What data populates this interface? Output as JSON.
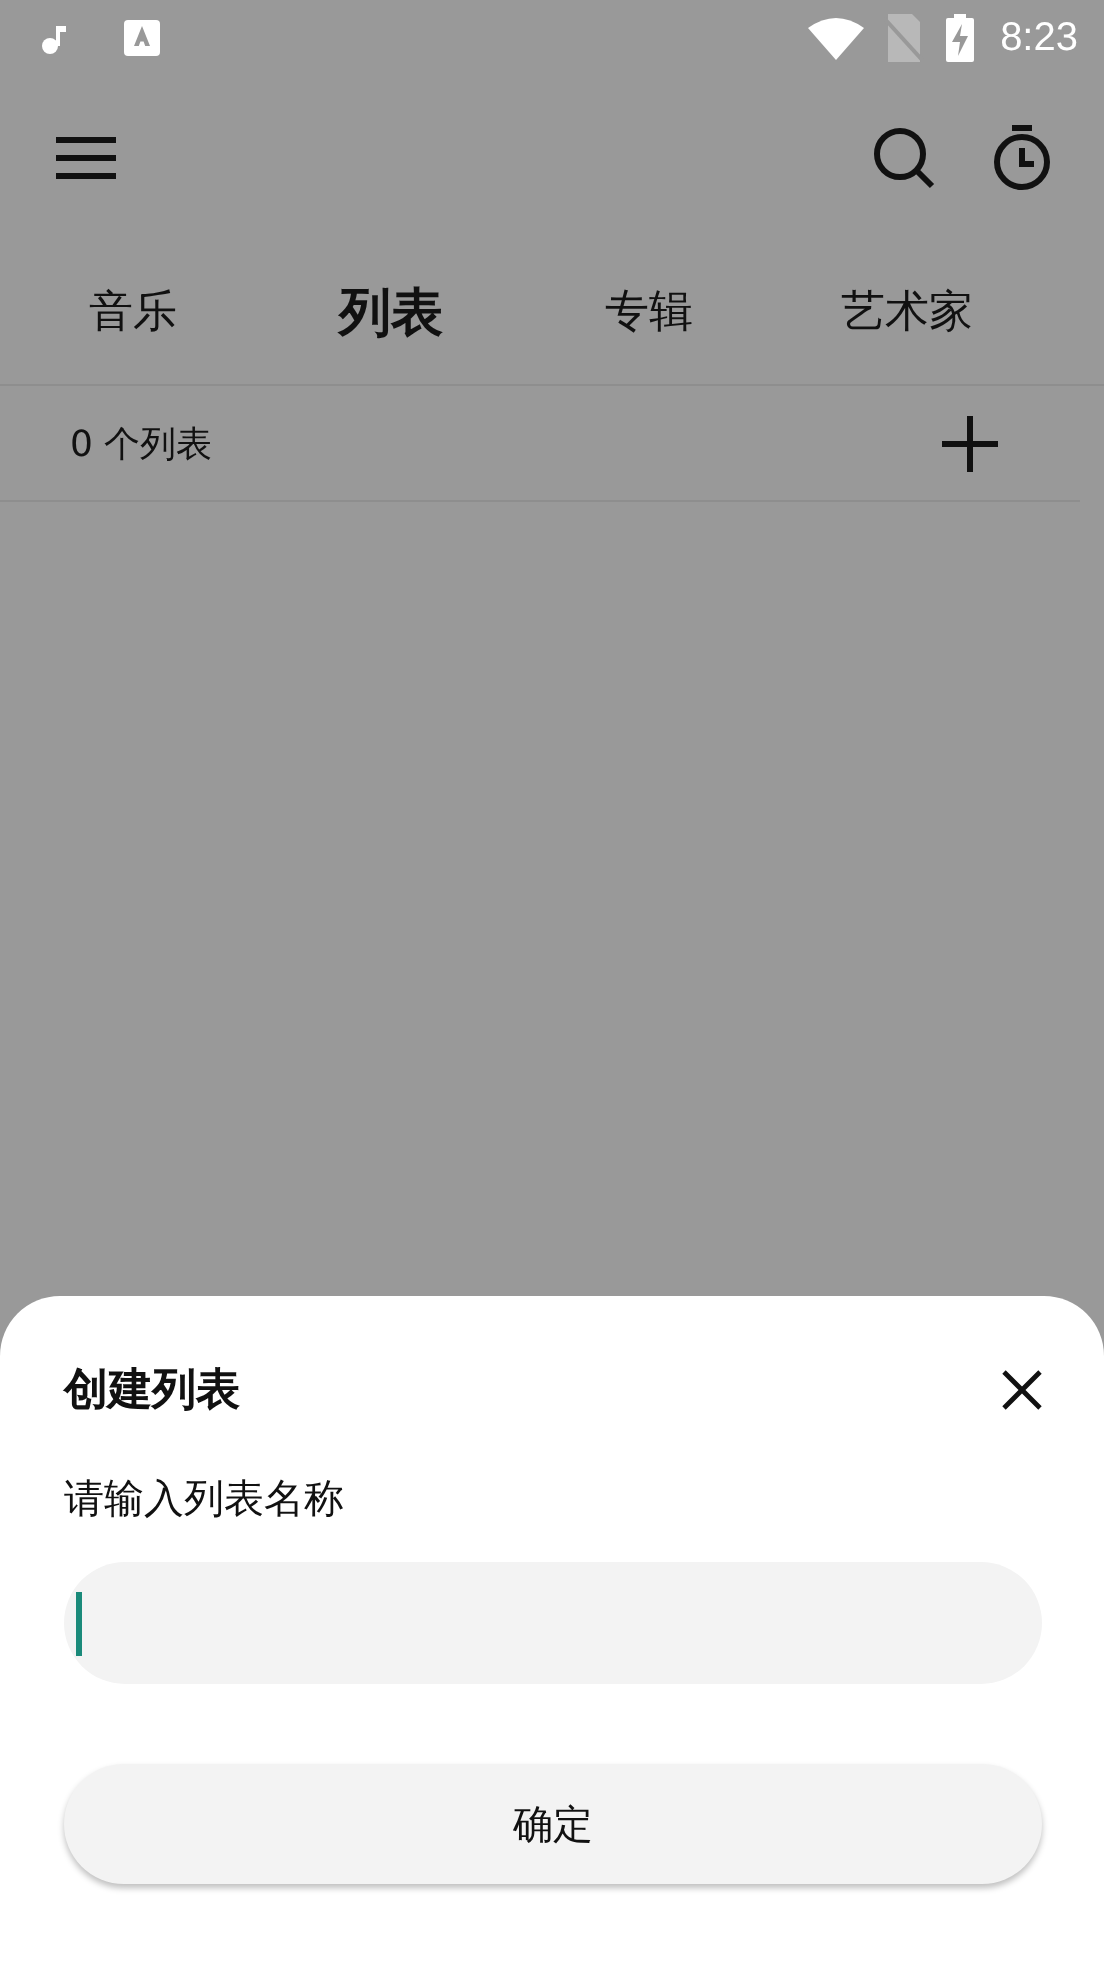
{
  "status_bar": {
    "time": "8:23"
  },
  "tabs": [
    {
      "label": "音乐",
      "selected": false
    },
    {
      "label": "列表",
      "selected": true
    },
    {
      "label": "专辑",
      "selected": false
    },
    {
      "label": "艺术家",
      "selected": false
    }
  ],
  "list_header": {
    "count": "0 个列表"
  },
  "dialog": {
    "title": "创建列表",
    "label": "请输入列表名称",
    "confirm_button": "确定"
  }
}
